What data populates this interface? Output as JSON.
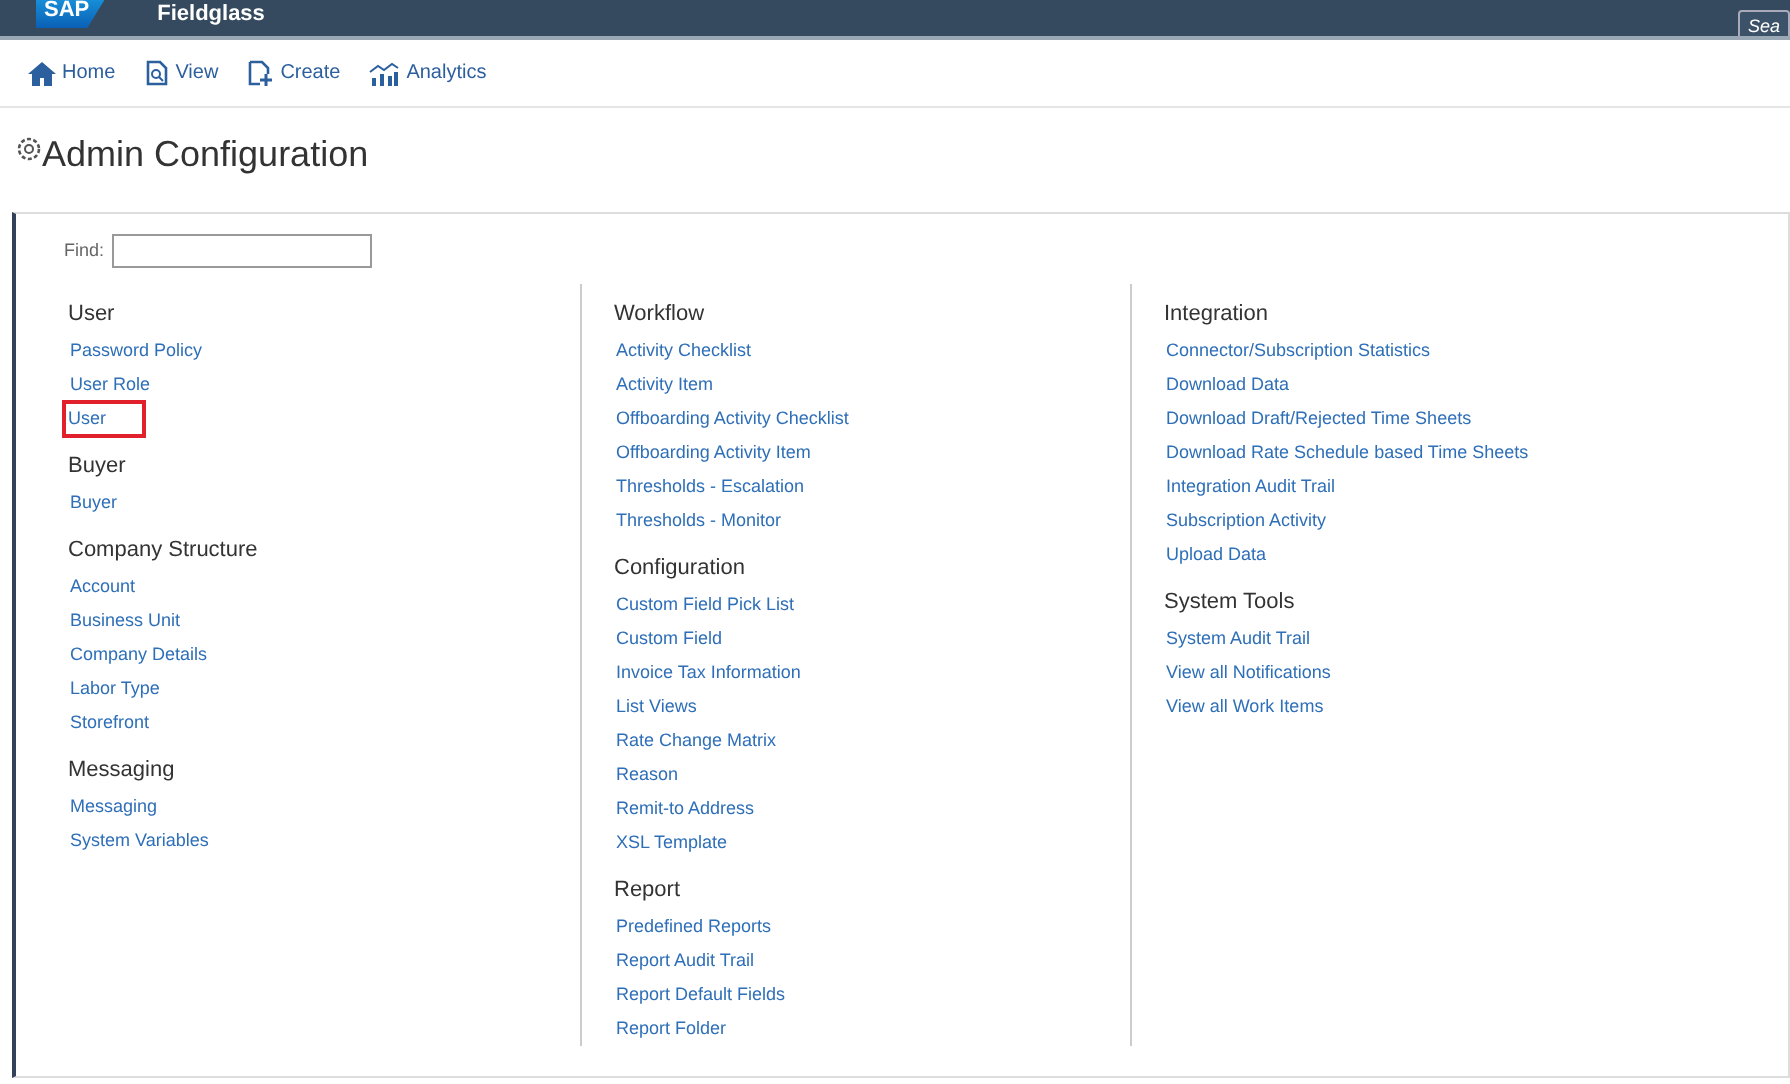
{
  "header": {
    "logo": "SAP",
    "product": "Fieldglass",
    "search_button": "Sea"
  },
  "nav": [
    {
      "label": "Home"
    },
    {
      "label": "View"
    },
    {
      "label": "Create"
    },
    {
      "label": "Analytics"
    }
  ],
  "page_title": "Admin Configuration",
  "find": {
    "label": "Find:"
  },
  "columns": [
    {
      "sections": [
        {
          "heading": "User",
          "links": [
            {
              "label": "Password Policy",
              "highlighted": false
            },
            {
              "label": "User Role",
              "highlighted": false
            },
            {
              "label": "User",
              "highlighted": true
            }
          ]
        },
        {
          "heading": "Buyer",
          "links": [
            {
              "label": "Buyer",
              "highlighted": false
            }
          ]
        },
        {
          "heading": "Company Structure",
          "links": [
            {
              "label": "Account",
              "highlighted": false
            },
            {
              "label": "Business Unit",
              "highlighted": false
            },
            {
              "label": "Company Details",
              "highlighted": false
            },
            {
              "label": "Labor Type",
              "highlighted": false
            },
            {
              "label": "Storefront",
              "highlighted": false
            }
          ]
        },
        {
          "heading": "Messaging",
          "links": [
            {
              "label": "Messaging",
              "highlighted": false
            },
            {
              "label": "System Variables",
              "highlighted": false
            }
          ]
        }
      ]
    },
    {
      "sections": [
        {
          "heading": "Workflow",
          "links": [
            {
              "label": "Activity Checklist",
              "highlighted": false
            },
            {
              "label": "Activity Item",
              "highlighted": false
            },
            {
              "label": "Offboarding Activity Checklist",
              "highlighted": false
            },
            {
              "label": "Offboarding Activity Item",
              "highlighted": false
            },
            {
              "label": "Thresholds - Escalation",
              "highlighted": false
            },
            {
              "label": "Thresholds - Monitor",
              "highlighted": false
            }
          ]
        },
        {
          "heading": "Configuration",
          "links": [
            {
              "label": "Custom Field Pick List",
              "highlighted": false
            },
            {
              "label": "Custom Field",
              "highlighted": false
            },
            {
              "label": "Invoice Tax Information",
              "highlighted": false
            },
            {
              "label": "List Views",
              "highlighted": false
            },
            {
              "label": "Rate Change Matrix",
              "highlighted": false
            },
            {
              "label": "Reason",
              "highlighted": false
            },
            {
              "label": "Remit-to Address",
              "highlighted": false
            },
            {
              "label": "XSL Template",
              "highlighted": false
            }
          ]
        },
        {
          "heading": "Report",
          "links": [
            {
              "label": "Predefined Reports",
              "highlighted": false
            },
            {
              "label": "Report Audit Trail",
              "highlighted": false
            },
            {
              "label": "Report Default Fields",
              "highlighted": false
            },
            {
              "label": "Report Folder",
              "highlighted": false
            }
          ]
        }
      ]
    },
    {
      "sections": [
        {
          "heading": "Integration",
          "links": [
            {
              "label": "Connector/Subscription Statistics",
              "highlighted": false
            },
            {
              "label": "Download Data",
              "highlighted": false
            },
            {
              "label": "Download Draft/Rejected Time Sheets",
              "highlighted": false
            },
            {
              "label": "Download Rate Schedule based Time Sheets",
              "highlighted": false
            },
            {
              "label": "Integration Audit Trail",
              "highlighted": false
            },
            {
              "label": "Subscription Activity",
              "highlighted": false
            },
            {
              "label": "Upload Data",
              "highlighted": false
            }
          ]
        },
        {
          "heading": "System Tools",
          "links": [
            {
              "label": "System Audit Trail",
              "highlighted": false
            },
            {
              "label": "View all Notifications",
              "highlighted": false
            },
            {
              "label": "View all Work Items",
              "highlighted": false
            }
          ]
        }
      ]
    }
  ]
}
